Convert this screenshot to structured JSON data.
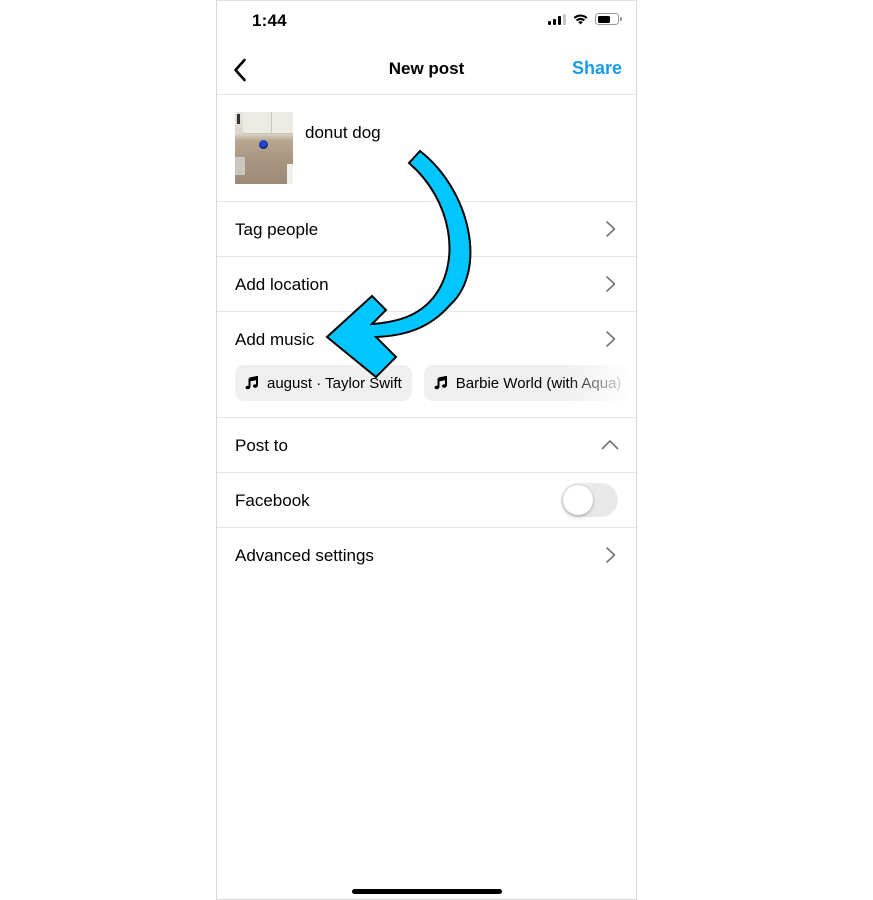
{
  "status_bar": {
    "time": "1:44",
    "signal_bars_filled": 3,
    "signal_bars_total": 4,
    "battery_level": 0.7,
    "icons": [
      "signal-icon",
      "wifi-icon",
      "battery-icon"
    ]
  },
  "nav": {
    "back_icon": "chevron-left-icon",
    "title": "New post",
    "share_label": "Share",
    "accent_color": "#1a9bf0"
  },
  "caption": {
    "thumbnail_alt": "dog bowl on tiled floor photo",
    "text": "donut dog"
  },
  "rows": {
    "tag_people": "Tag people",
    "add_location": "Add location",
    "add_music": "Add music",
    "post_to": "Post to",
    "facebook": "Facebook",
    "advanced_settings": "Advanced settings"
  },
  "music_suggestions": [
    {
      "label": "august · Taylor Swift",
      "icon": "music-note-icon"
    },
    {
      "label": "Barbie World (with Aqua)",
      "icon": "music-note-icon"
    }
  ],
  "facebook_toggle": {
    "on": false
  },
  "post_to_expanded": true,
  "annotation": {
    "type": "curved-arrow",
    "color": "#00c6ff",
    "points_to": "Add music"
  }
}
